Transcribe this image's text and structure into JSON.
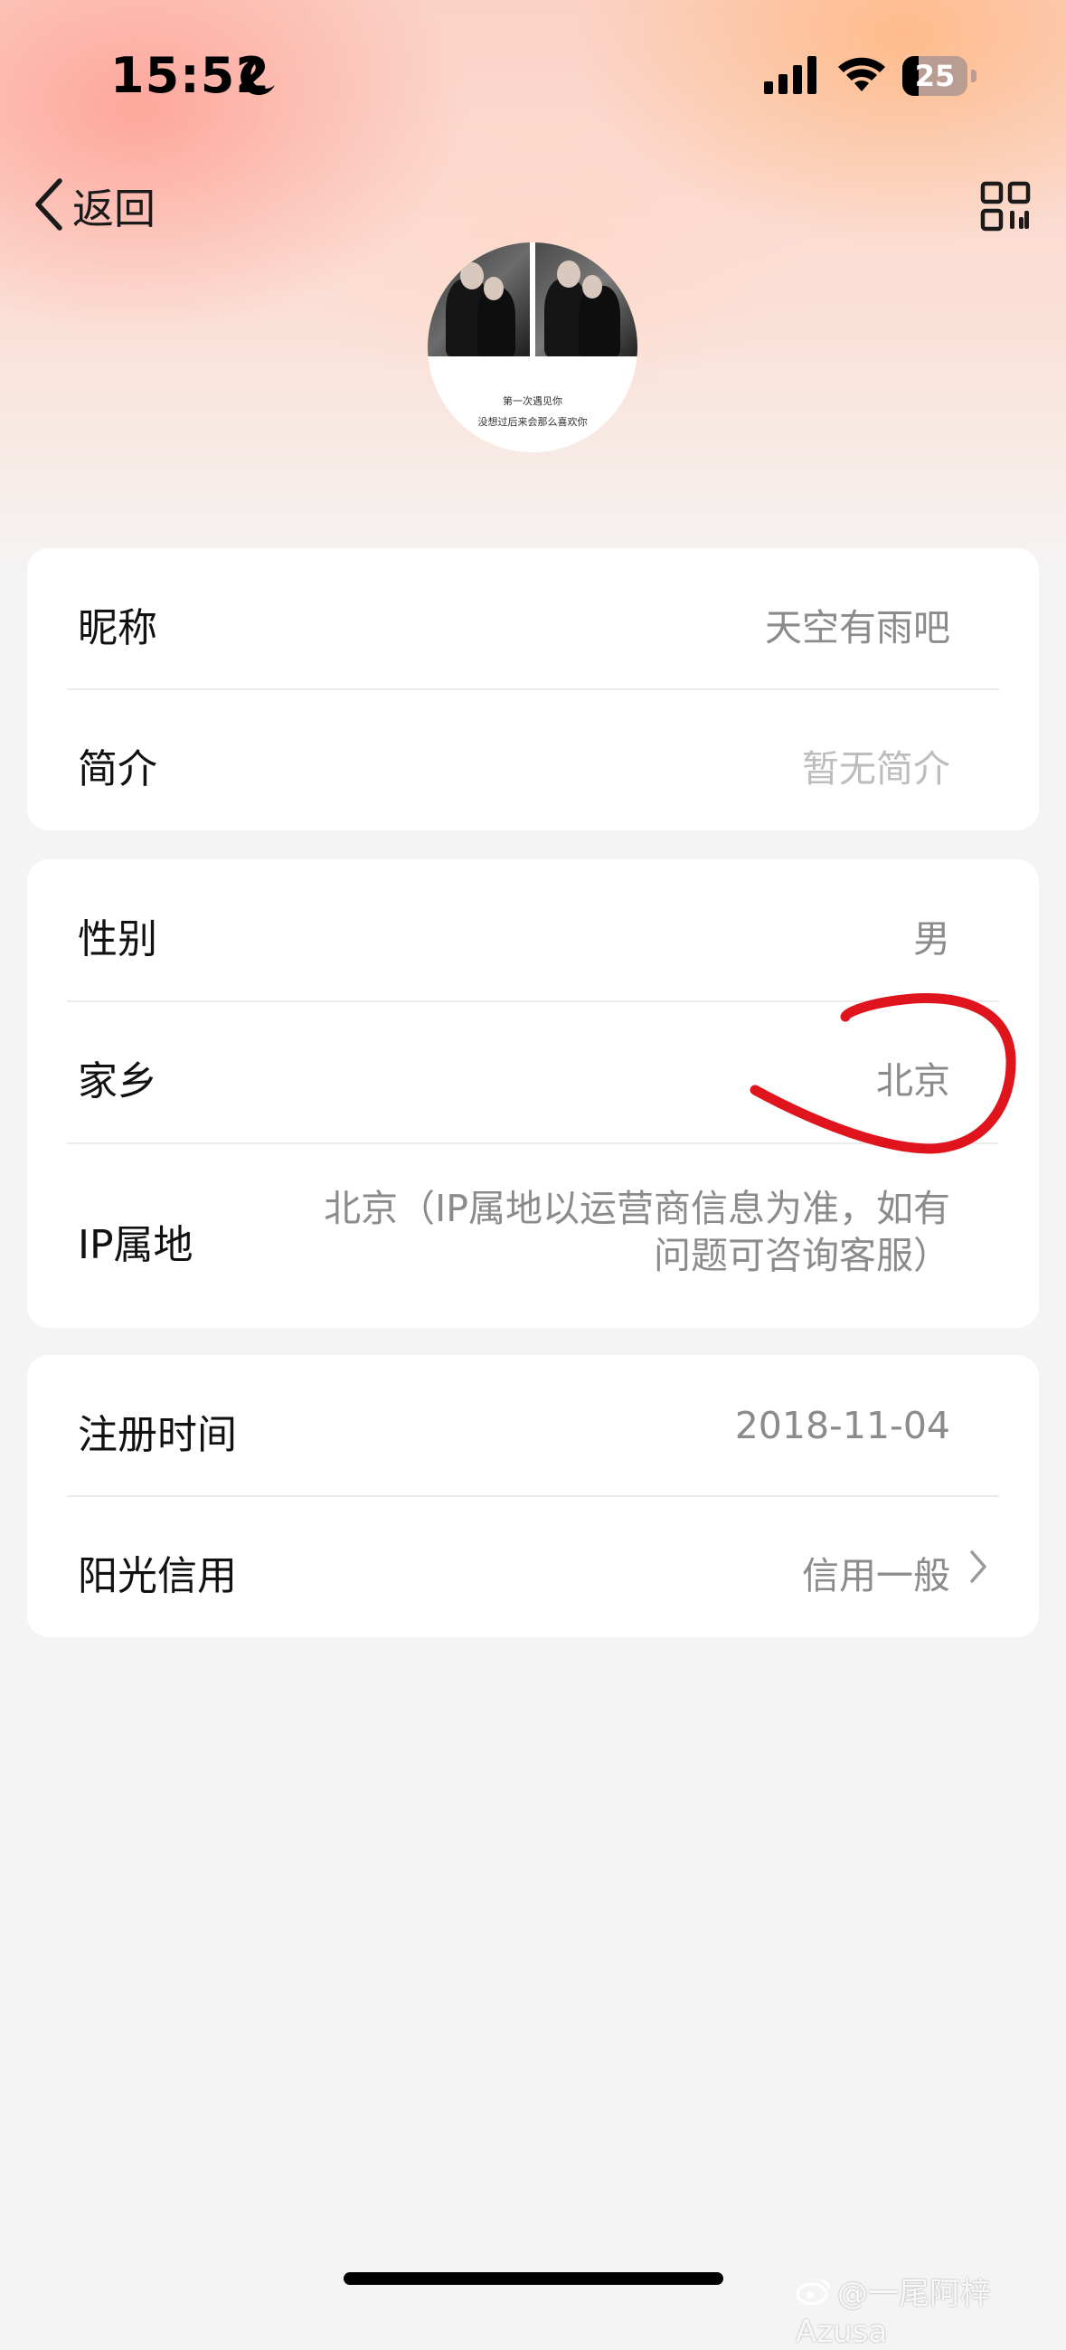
{
  "status_bar": {
    "time": "15:52",
    "battery_level": "25",
    "battery_fraction": 0.25,
    "icons": [
      "moon-icon",
      "signal-icon",
      "wifi-icon",
      "battery-icon"
    ]
  },
  "nav": {
    "back_label": "返回",
    "qr_icon": "qr-code-icon"
  },
  "avatar": {
    "line1": "第一次遇见你",
    "line2": "没想过后来会那么喜欢你"
  },
  "profile": {
    "nickname_label": "昵称",
    "nickname_value": "天空有雨吧",
    "bio_label": "简介",
    "bio_value": "暂无简介",
    "gender_label": "性别",
    "gender_value": "男",
    "hometown_label": "家乡",
    "hometown_value": "北京",
    "ip_label": "IP属地",
    "ip_value_line1": "北京（IP属地以运营商信息为准，如有",
    "ip_value_line2": "问题可咨询客服）",
    "register_label": "注册时间",
    "register_value": "2018-11-04",
    "credit_label": "阳光信用",
    "credit_value": "信用一般"
  },
  "watermark": "@一尾阿梓Azusa",
  "colors": {
    "annotation": "#e0141c",
    "value_text": "#8b8b8b",
    "placeholder_text": "#bdbdbd"
  }
}
